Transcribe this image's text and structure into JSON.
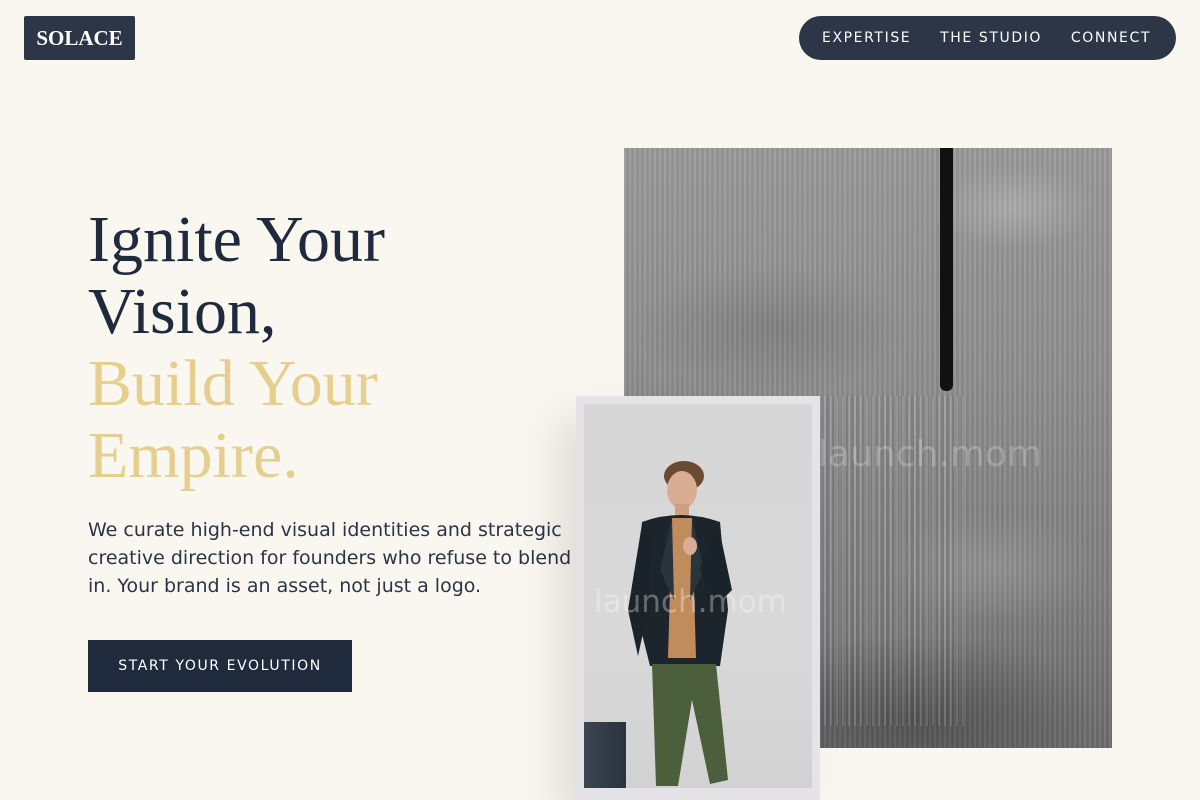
{
  "header": {
    "logo": "SOLACE",
    "nav": [
      {
        "label": "EXPERTISE"
      },
      {
        "label": "THE STUDIO"
      },
      {
        "label": "CONNECT"
      }
    ]
  },
  "hero": {
    "headline_line1": "Ignite Your",
    "headline_line2": "Vision,",
    "headline_accent_line1": "Build Your",
    "headline_accent_line2": "Empire.",
    "description": "We curate high-end visual identities and strategic creative direction for founders who refuse to blend in. Your brand is an asset, not just a logo.",
    "cta_label": "START YOUR EVOLUTION"
  },
  "images": {
    "texture_watermark": "launch.mom",
    "portrait_watermark": "launch.mom"
  },
  "colors": {
    "background": "#faf7f1",
    "navy": "#1f2a3c",
    "nav_bg": "#2c3647",
    "gold_accent": "#e6cf8e"
  }
}
